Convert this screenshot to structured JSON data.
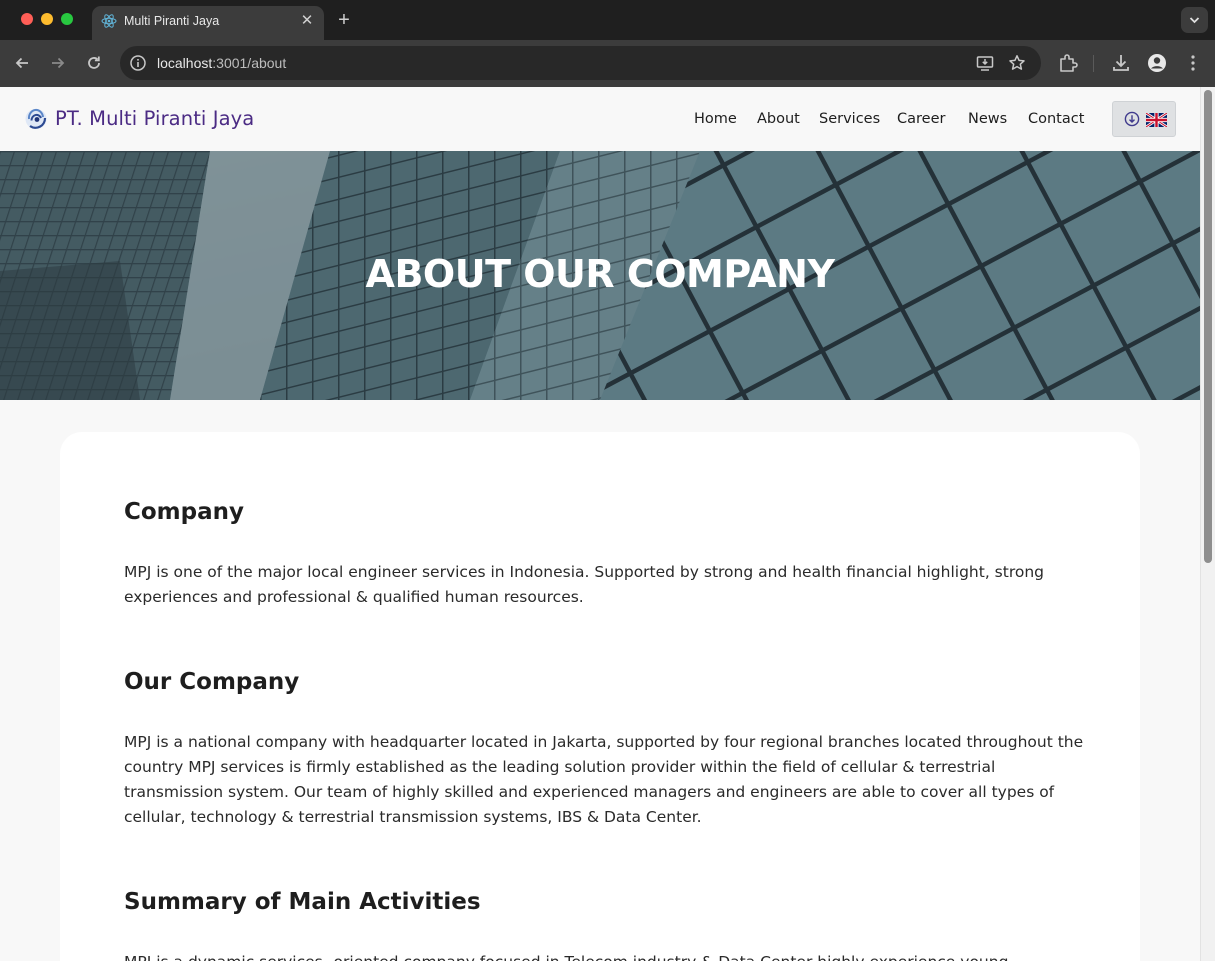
{
  "browser": {
    "tab_title": "Multi Piranti Jaya",
    "url_host": "localhost",
    "url_path": ":3001/about",
    "icons": [
      "react-favicon-icon",
      "close-icon",
      "plus-icon",
      "chevron-down-icon",
      "back-icon",
      "forward-icon",
      "reload-icon",
      "info-icon",
      "install-app-icon",
      "star-icon",
      "extensions-icon",
      "download-icon",
      "profile-icon",
      "kebab-menu-icon"
    ]
  },
  "site": {
    "logo_text": "PT. Multi Piranti Jaya",
    "brand_color": "#4b2b84",
    "nav": [
      "Home",
      "About",
      "Services",
      "Career",
      "News",
      "Contact"
    ],
    "language": {
      "icons": [
        "arrow-down-circle-icon",
        "uk-flag-icon"
      ]
    }
  },
  "hero": {
    "title": "ABOUT OUR COMPANY"
  },
  "sections": [
    {
      "heading": "Company",
      "text": "MPJ is one of the major local engineer services in Indonesia. Supported by strong and health financial highlight, strong experiences and professional & qualified human resources."
    },
    {
      "heading": "Our Company",
      "text": "MPJ is a national company with headquarter located in Jakarta, supported by four regional branches located throughout the country MPJ services is firmly established as the leading solution provider within the field of cellular & terrestrial transmission system. Our team of highly skilled and experienced managers and engineers are able to cover all types of cellular, technology & terrestrial transmission systems, IBS & Data Center."
    },
    {
      "heading": "Summary of Main Activities",
      "text": "MPJ is a dynamic services -oriented company focused in Telecom industry & Data Center highly experience young"
    }
  ]
}
